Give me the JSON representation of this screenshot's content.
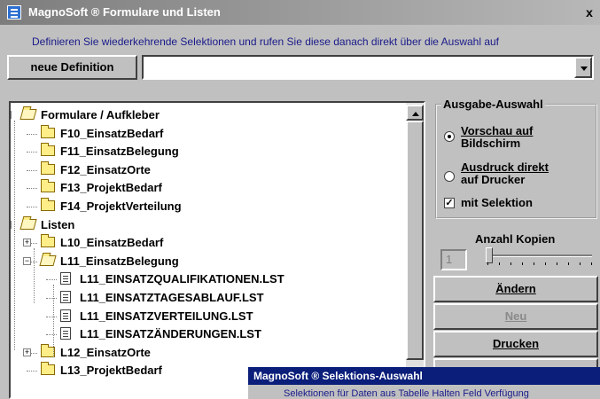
{
  "window": {
    "title": "MagnoSoft ® Formulare und Listen",
    "close_label": "x"
  },
  "description": "Definieren Sie wiederkehrende Selektionen und rufen Sie diese danach direkt über die Auswahl auf",
  "definition": {
    "button_label": "neue Definition",
    "combo_value": ""
  },
  "tree": {
    "items": [
      {
        "label": "Formulare / Aufkleber",
        "type": "folder-open",
        "expander": "−"
      },
      {
        "label": "F10_EinsatzBedarf",
        "type": "folder"
      },
      {
        "label": "F11_EinsatzBelegung",
        "type": "folder"
      },
      {
        "label": "F12_EinsatzOrte",
        "type": "folder"
      },
      {
        "label": "F13_ProjektBedarf",
        "type": "folder"
      },
      {
        "label": "F14_ProjektVerteilung",
        "type": "folder"
      },
      {
        "label": "Listen",
        "type": "folder-open",
        "expander": "−"
      },
      {
        "label": "L10_EinsatzBedarf",
        "type": "folder",
        "expander": "+"
      },
      {
        "label": "L11_EinsatzBelegung",
        "type": "folder-open",
        "expander": "−"
      },
      {
        "label": "L11_EINSATZQUALIFIKATIONEN.LST",
        "type": "file"
      },
      {
        "label": "L11_EINSATZTAGESABLAUF.LST",
        "type": "file"
      },
      {
        "label": "L11_EINSATZVERTEILUNG.LST",
        "type": "file"
      },
      {
        "label": "L11_EINSATZÄNDERUNGEN.LST",
        "type": "file"
      },
      {
        "label": "L12_EinsatzOrte",
        "type": "folder",
        "expander": "+"
      },
      {
        "label": "L13_ProjektBedarf",
        "type": "folder"
      }
    ]
  },
  "output": {
    "legend": "Ausgabe-Auswahl",
    "screen_label_1": "Vorschau auf",
    "screen_label_2": "Bildschirm",
    "print_label_1": "Ausdruck direkt",
    "print_label_2": "auf Drucker",
    "selection_label": "mit Selektion",
    "selected": "screen",
    "with_selection": true
  },
  "copies": {
    "label": "Anzahl Kopien",
    "value": "1"
  },
  "buttons": {
    "change": "Ändern",
    "new": "Neu",
    "print": "Drucken"
  },
  "popup": {
    "title": "MagnoSoft ® Selektions-Auswahl",
    "text": "Selektionen für Daten aus Tabelle Halten  Feld Verfügung"
  }
}
